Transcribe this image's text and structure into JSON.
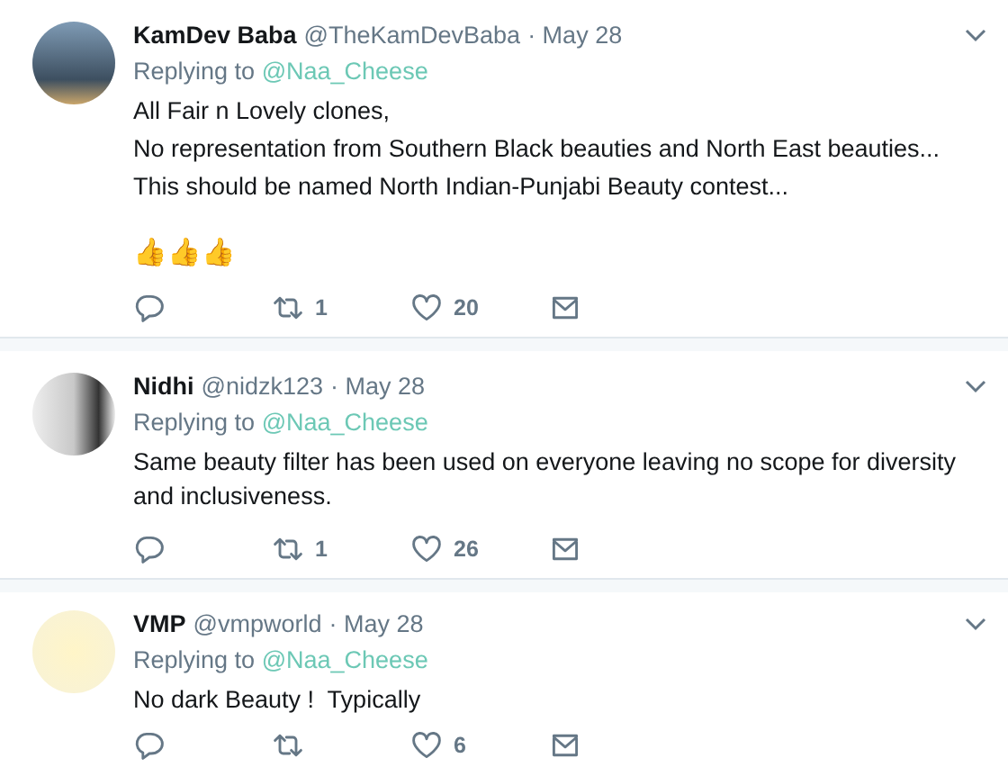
{
  "tweets": [
    {
      "name": "KamDev Baba",
      "handle": "@TheKamDevBaba",
      "date": "· May 28",
      "replying_label": "Replying to",
      "replying_to": "@Naa_Cheese",
      "body": [
        "All Fair n Lovely clones,",
        "No representation from Southern Black beauties and North East beauties...",
        "This should be named North Indian-Punjabi Beauty contest..."
      ],
      "emoji": "👍👍👍",
      "retweets": "1",
      "likes": "20"
    },
    {
      "name": "Nidhi",
      "handle": "@nidzk123",
      "date": "· May 28",
      "replying_label": "Replying to",
      "replying_to": "@Naa_Cheese",
      "body": [
        "Same beauty filter has been used on everyone leaving no scope for diversity and inclusiveness."
      ],
      "retweets": "1",
      "likes": "26"
    },
    {
      "name": "VMP",
      "handle": "@vmpworld",
      "date": "· May 28",
      "replying_label": "Replying to",
      "replying_to": "@Naa_Cheese",
      "body": [
        "No dark Beauty !  Typically"
      ],
      "likes": "6"
    }
  ]
}
